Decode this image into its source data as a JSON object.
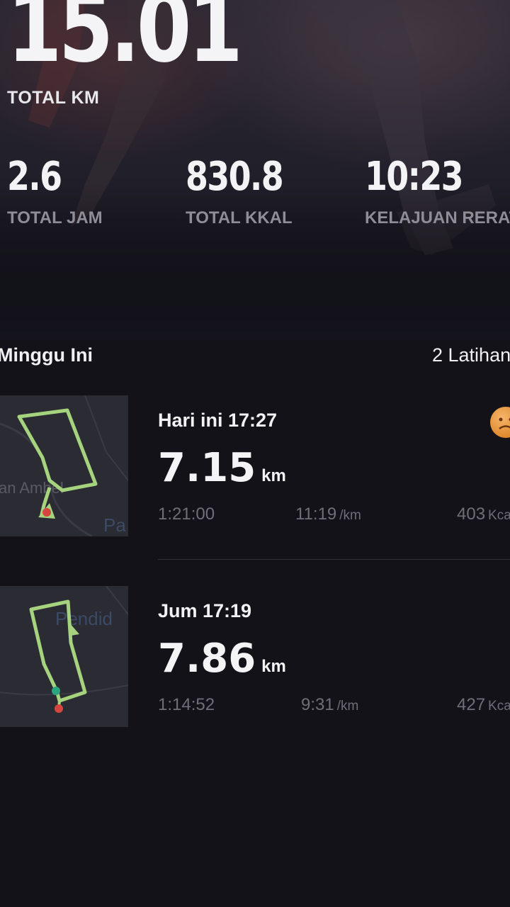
{
  "summary": {
    "total_km_value": "15.01",
    "total_km_label": "TOTAL KM",
    "stats": [
      {
        "value": "2.6",
        "label": "TOTAL JAM"
      },
      {
        "value": "830.8",
        "label": "TOTAL KKAL"
      },
      {
        "value": "10:23",
        "label": "KELAJUAN RERATA"
      }
    ]
  },
  "week": {
    "title": "Minggu Ini",
    "count": "2 Latihan"
  },
  "activities": [
    {
      "date": "Hari ini 17:27",
      "distance": "7.15",
      "unit": "km",
      "duration": "1:21:00",
      "pace": "11:19",
      "pace_unit": "/km",
      "calories": "403",
      "cal_unit": "Kcal",
      "map_labels": [
        "an Ambel",
        "Pa"
      ],
      "mood_icon": "sad-face-icon"
    },
    {
      "date": "Jum 17:19",
      "distance": "7.86",
      "unit": "km",
      "duration": "1:14:52",
      "pace": "9:31",
      "pace_unit": "/km",
      "calories": "427",
      "cal_unit": "Kcal",
      "map_labels": [
        "Pendid"
      ]
    }
  ],
  "colors": {
    "route": "#a6d37d",
    "start_dot": "#2aa57e",
    "end_dot": "#d6453f",
    "mood": "#e8953a"
  }
}
